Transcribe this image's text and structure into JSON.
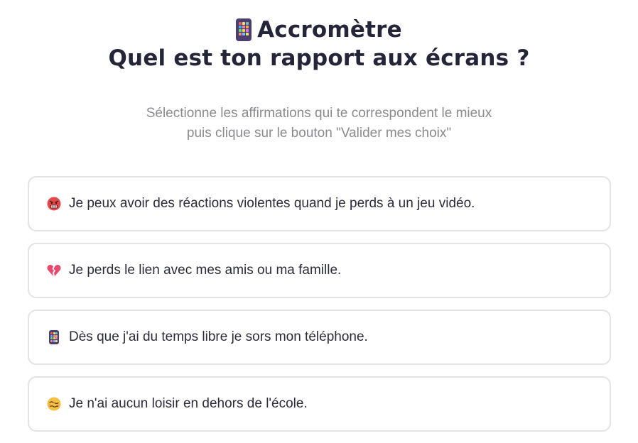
{
  "header": {
    "app_name": "Accromètre",
    "question": "Quel est ton rapport aux écrans ?",
    "app_icon": "mobile-phone-icon"
  },
  "instructions": {
    "line1": "Sélectionne les affirmations qui te correspondent le mieux",
    "line2": "puis clique sur le bouton \"Valider mes choix\""
  },
  "options": [
    {
      "icon": "angry-face-icon",
      "label": "Je peux avoir des réactions violentes quand je perds à un jeu vidéo."
    },
    {
      "icon": "broken-heart-icon",
      "label": "Je perds le lien avec mes amis ou ma famille."
    },
    {
      "icon": "mobile-phone-icon",
      "label": "Dès que j'ai du temps libre je sors mon téléphone."
    },
    {
      "icon": "woozy-face-icon",
      "label": "Je n'ai aucun loisir en dehors de l'école."
    }
  ],
  "colors": {
    "title": "#25253a",
    "subtitle": "#8a8a8f",
    "card_border": "#e3e3e6",
    "phone_body": "#4b3f72"
  }
}
